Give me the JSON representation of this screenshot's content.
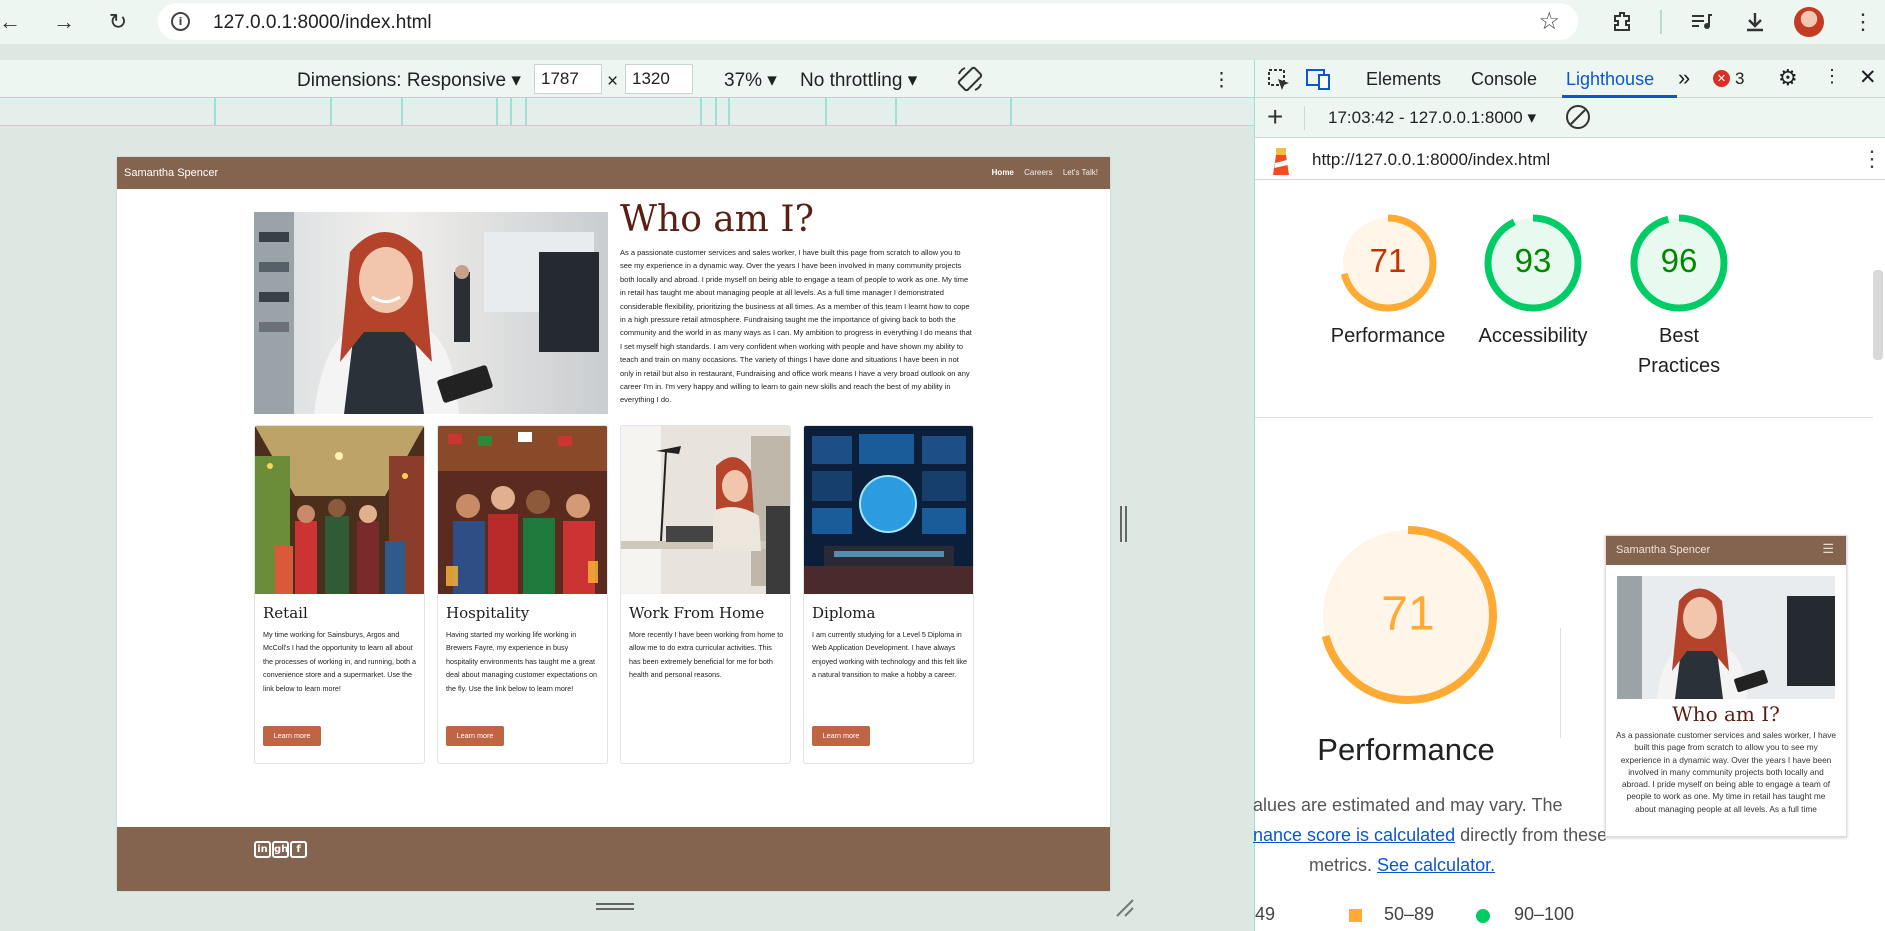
{
  "browser": {
    "url": "127.0.0.1:8000/index.html",
    "icons": [
      "back-icon",
      "forward-icon",
      "reload-icon",
      "site-info-icon",
      "bookmark-star-icon",
      "extensions-icon",
      "media-icon",
      "downloads-icon",
      "profile-avatar"
    ]
  },
  "device_toolbar": {
    "dimensions": "Dimensions: Responsive",
    "width": "1787",
    "times": "×",
    "height": "1320",
    "zoom": "37%",
    "throttling": "No throttling"
  },
  "site": {
    "brand": "Samantha Spencer",
    "nav": [
      "Home",
      "Careers",
      "Let's Talk!"
    ],
    "hero_title": "Who am I?",
    "hero_text": "As a passionate customer services and sales worker, I have built this page from scratch to allow you to see my experience in a dynamic way. Over the years I have been involved in many community projects both locally and abroad. I pride myself on being able to engage a team of people to work as one. My time in retail has taught me about managing people at all levels. As a full time manager I demonstrated considerable flexibility, prioritizing the business at all times. As a member of this team I learnt how to cope in a high pressure retail atmosphere. Fundraising taught me the importance of giving back to both the community and the world in as many ways as I can. My ambition to progress in everything I do means that I set myself high standards. I am very confident when working with people and have shown my ability to teach and train on many occasions. The variety of things I have done and situations I have been in not only in retail but also in restaurant, Fundraising and office work means I have a very broad outlook on any career I'm in. I'm very happy and willing to learn to gain new skills and reach the best of my ability in everything I do.",
    "cards": [
      {
        "title": "Retail",
        "text": "My time working for Sainsburys, Argos and McColl's I had the opportunity to learn all about the processes of working in, and running, both a convenience store and a supermarket. Use the link below to learn more!",
        "button": "Learn more"
      },
      {
        "title": "Hospitality",
        "text": "Having started my working life working in Brewers Fayre, my experience in busy hospitality environments has taught me a great deal about managing customer expectations on the fly. Use the link below to learn more!",
        "button": "Learn more"
      },
      {
        "title": "Work From Home",
        "text": "More recently I have been working from home to allow me to do extra curricular activities. This has been extremely beneficial for me for both health and personal reasons.",
        "button": ""
      },
      {
        "title": "Diploma",
        "text": "I am currently studying for a Level 5 Diploma in Web Application Development. I have always enjoyed working with technology and this felt like a natural transition to make a hobby a career.",
        "button": "Learn more"
      }
    ],
    "footer_icons": [
      "in",
      "gh",
      "f"
    ]
  },
  "devtools": {
    "tabs": [
      "Elements",
      "Console",
      "Lighthouse"
    ],
    "more": "»",
    "error_count": "3",
    "report_time": "17:03:42 - 127.0.0.1:8000",
    "report_url": "http://127.0.0.1:8000/index.html",
    "scores": [
      {
        "label": "Performance",
        "value": 71,
        "color": "#fa3",
        "bg": "#fff5e8",
        "text": "#c33300"
      },
      {
        "label": "Accessibility",
        "value": 93,
        "color": "#0c6",
        "bg": "#e8faf0",
        "text": "#008800"
      },
      {
        "label": "Best Practices",
        "value": 96,
        "color": "#0c6",
        "bg": "#e8faf0",
        "text": "#008800"
      }
    ],
    "big_score": {
      "value": 71,
      "label": "Performance",
      "color": "#fa3",
      "bg": "#fff5e8"
    },
    "estimate_text_1": "alues are estimated and may vary. The",
    "estimate_link": "nance score is calculated",
    "estimate_text_2": " directly from these",
    "metrics_text": "metrics.",
    "calculator_link": "See calculator.",
    "legend": [
      "49",
      "50–89",
      "90–100"
    ],
    "thumb": {
      "brand": "Samantha Spencer",
      "title": "Who am I?",
      "text": "As a passionate customer services and sales worker, I have built this page from scratch to allow you to see my experience in a dynamic way. Over the years I have been involved in many community projects both locally and abroad. I pride myself on being able to engage a team of people to work as one. My time in retail has taught me about managing people at all levels. As a full time"
    }
  }
}
